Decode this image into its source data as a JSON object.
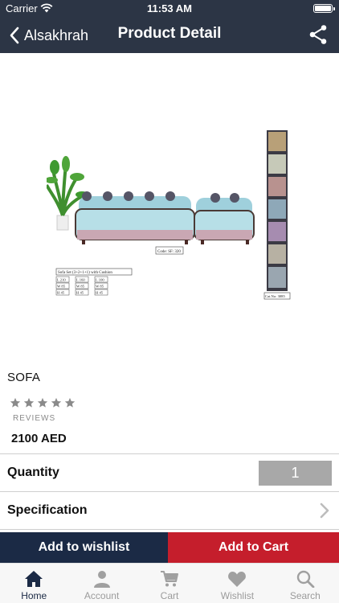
{
  "status_bar": {
    "carrier": "Carrier",
    "time": "11:53 AM"
  },
  "nav": {
    "back_label": "Alsakhrah",
    "title": "Product Detail"
  },
  "product": {
    "image_text": {
      "code": "Code: SF: 320",
      "set_title": "Sofa Set (3+2+1+1) with Cushion",
      "dims": [
        [
          "L 210",
          "L 160",
          "L 100"
        ],
        [
          "W 85",
          "W 85",
          "W 85"
        ],
        [
          "H 45",
          "H 45",
          "H 45"
        ]
      ],
      "cat_no": "Cat.No: 3085"
    },
    "name": "SOFA",
    "rating_stars": 5,
    "reviews_label": "REVIEWS",
    "price": "2100 AED"
  },
  "quantity": {
    "label": "Quantity",
    "value": "1"
  },
  "specification": {
    "label": "Specification"
  },
  "actions": {
    "wishlist_label": "Add to wishlist",
    "cart_label": "Add to Cart"
  },
  "tabbar": {
    "tabs": [
      {
        "label": "Home",
        "icon": "home-icon"
      },
      {
        "label": "Account",
        "icon": "account-icon"
      },
      {
        "label": "Cart",
        "icon": "cart-icon"
      },
      {
        "label": "Wishlist",
        "icon": "heart-icon"
      },
      {
        "label": "Search",
        "icon": "search-icon"
      }
    ],
    "active_index": 0
  },
  "colors": {
    "header_bg": "#2c3545",
    "wishlist_bg": "#1b2a45",
    "cart_bg": "#c51e2c",
    "qty_bg": "#a8a8a8"
  }
}
